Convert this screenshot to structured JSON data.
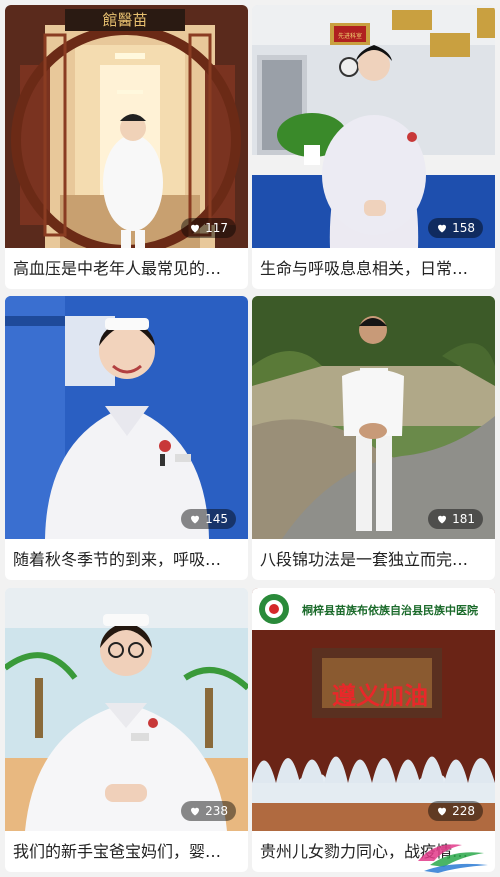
{
  "cards": [
    {
      "caption": "高血压是中老年人最常见的…",
      "likes": "117",
      "sign": "館醫苗"
    },
    {
      "caption": "生命与呼吸息息相关，日常…",
      "likes": "158",
      "sign": "先进科室"
    },
    {
      "caption": "随着秋冬季节的到来，呼吸…",
      "likes": "145",
      "sign": ""
    },
    {
      "caption": "八段锦功法是一套独立而完…",
      "likes": "181",
      "sign": ""
    },
    {
      "caption": "我们的新手宝爸宝妈们，婴…",
      "likes": "238",
      "sign": ""
    },
    {
      "caption": "贵州儿女勠力同心，战疫情…",
      "likes": "228",
      "sign": "遵义加油"
    }
  ],
  "hospital_banner": "桐梓县苗族布依族自治县民族中医院",
  "icons": {
    "like": "heart-icon"
  },
  "colors": {
    "accent_red": "#d4282a",
    "page_bg": "#f2f2f2"
  }
}
